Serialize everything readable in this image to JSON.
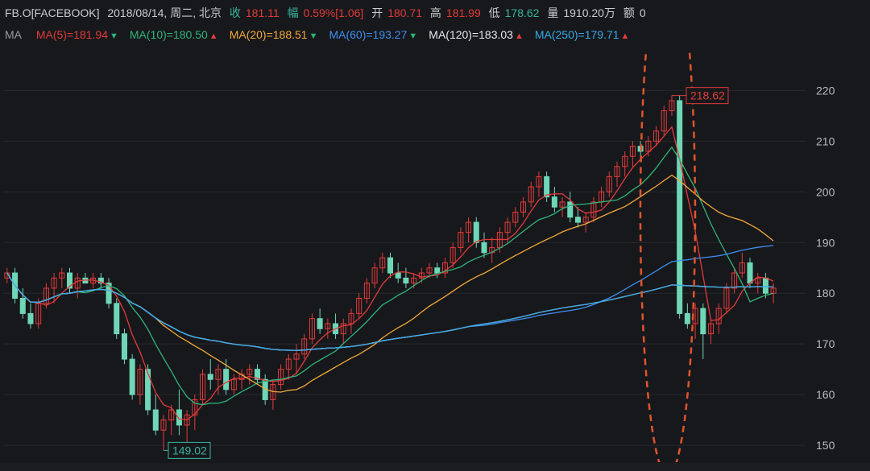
{
  "header": {
    "symbol": "FB.O[FACEBOOK]",
    "datetime": "2018/08/14, 周二, 北京",
    "close_label": "收",
    "close_value": "181.11",
    "change_label": "幅",
    "change_pct": "0.59%",
    "change_abs": "[1.06]",
    "open_label": "开",
    "open_value": "180.71",
    "high_label": "高",
    "high_value": "181.99",
    "low_label": "低",
    "low_value": "178.62",
    "volume_label": "量",
    "volume_value": "1910.20万",
    "amount_label": "额",
    "amount_value": "0"
  },
  "ma_legend": {
    "label": "MA",
    "items": [
      {
        "text": "MA(5)=181.94",
        "dir": "down",
        "color": "#e23b3b"
      },
      {
        "text": "MA(10)=180.50",
        "dir": "up",
        "color": "#2fb67c"
      },
      {
        "text": "MA(20)=188.51",
        "dir": "down",
        "color": "#f2a93b"
      },
      {
        "text": "MA(60)=193.27",
        "dir": "down",
        "color": "#3d8ff0"
      },
      {
        "text": "MA(120)=183.03",
        "dir": "up",
        "color": "#e8e8e8"
      },
      {
        "text": "MA(250)=179.71",
        "dir": "up",
        "color": "#38a9e8"
      }
    ]
  },
  "colors": {
    "background": "#17181b",
    "up_candle": "#e23b3b",
    "down_candle": "#6fd6b6",
    "label_value_red": "#e23b3b",
    "label_value_green": "#38b6a0",
    "annotation": "#e0552c"
  },
  "annotations": {
    "high_label": "218.62",
    "low_label": "149.02"
  },
  "chart_data": {
    "type": "candlestick",
    "y_ticks": [
      150,
      160,
      170,
      180,
      190,
      200,
      210,
      220
    ],
    "ylim": [
      147,
      228
    ],
    "candles": [
      [
        183,
        185,
        182,
        184
      ],
      [
        184,
        185,
        178,
        179
      ],
      [
        179,
        181,
        175,
        176
      ],
      [
        176,
        178,
        173,
        174
      ],
      [
        174,
        179,
        173,
        178
      ],
      [
        178,
        182,
        177,
        181
      ],
      [
        181,
        184,
        178,
        183
      ],
      [
        183,
        185,
        181,
        184
      ],
      [
        184,
        185,
        180,
        181
      ],
      [
        181,
        184,
        179,
        183
      ],
      [
        183,
        184,
        182,
        182
      ],
      [
        182,
        184,
        181,
        183
      ],
      [
        183,
        184,
        181,
        182
      ],
      [
        182,
        183,
        177,
        178
      ],
      [
        178,
        179,
        171,
        172
      ],
      [
        172,
        173,
        166,
        167
      ],
      [
        167,
        168,
        159,
        160
      ],
      [
        160,
        166,
        158,
        165
      ],
      [
        165,
        166,
        156,
        157
      ],
      [
        157,
        160,
        152,
        153
      ],
      [
        153,
        156,
        149,
        155
      ],
      [
        155,
        158,
        152,
        157
      ],
      [
        157,
        161,
        152,
        154
      ],
      [
        154,
        157,
        150,
        156
      ],
      [
        156,
        160,
        153,
        159
      ],
      [
        159,
        165,
        158,
        164
      ],
      [
        164,
        167,
        161,
        163
      ],
      [
        163,
        166,
        160,
        165
      ],
      [
        165,
        167,
        160,
        161
      ],
      [
        161,
        164,
        160,
        163
      ],
      [
        163,
        165,
        161,
        164
      ],
      [
        164,
        166,
        162,
        165
      ],
      [
        165,
        166,
        162,
        163
      ],
      [
        163,
        164,
        158,
        159
      ],
      [
        159,
        163,
        157,
        162
      ],
      [
        162,
        166,
        161,
        165
      ],
      [
        165,
        168,
        163,
        167
      ],
      [
        167,
        170,
        164,
        168
      ],
      [
        168,
        172,
        167,
        171
      ],
      [
        171,
        176,
        170,
        175
      ],
      [
        175,
        177,
        172,
        173
      ],
      [
        173,
        175,
        171,
        174
      ],
      [
        174,
        176,
        171,
        172
      ],
      [
        172,
        175,
        170,
        174
      ],
      [
        174,
        177,
        172,
        176
      ],
      [
        176,
        180,
        175,
        179
      ],
      [
        179,
        183,
        178,
        182
      ],
      [
        182,
        186,
        181,
        185
      ],
      [
        185,
        188,
        184,
        187
      ],
      [
        187,
        188,
        183,
        184
      ],
      [
        184,
        186,
        182,
        183
      ],
      [
        183,
        185,
        181,
        182
      ],
      [
        182,
        184,
        181,
        183
      ],
      [
        183,
        185,
        182,
        184
      ],
      [
        184,
        186,
        183,
        185
      ],
      [
        185,
        186,
        183,
        184
      ],
      [
        184,
        187,
        183,
        186
      ],
      [
        186,
        190,
        185,
        189
      ],
      [
        189,
        193,
        188,
        192
      ],
      [
        192,
        195,
        190,
        194
      ],
      [
        194,
        195,
        189,
        190
      ],
      [
        190,
        192,
        187,
        188
      ],
      [
        188,
        191,
        186,
        189
      ],
      [
        189,
        193,
        188,
        192
      ],
      [
        192,
        195,
        190,
        194
      ],
      [
        194,
        197,
        193,
        196
      ],
      [
        196,
        199,
        195,
        198
      ],
      [
        198,
        202,
        197,
        201
      ],
      [
        201,
        204,
        199,
        203
      ],
      [
        203,
        204,
        198,
        199
      ],
      [
        199,
        201,
        196,
        197
      ],
      [
        197,
        199,
        195,
        198
      ],
      [
        198,
        200,
        194,
        195
      ],
      [
        195,
        197,
        193,
        194
      ],
      [
        194,
        196,
        192,
        195
      ],
      [
        195,
        199,
        194,
        198
      ],
      [
        198,
        201,
        197,
        200
      ],
      [
        200,
        204,
        199,
        203
      ],
      [
        203,
        206,
        201,
        205
      ],
      [
        205,
        208,
        203,
        207
      ],
      [
        207,
        210,
        205,
        209
      ],
      [
        209,
        210,
        206,
        208
      ],
      [
        208,
        211,
        207,
        210
      ],
      [
        210,
        213,
        209,
        212
      ],
      [
        212,
        217,
        211,
        216
      ],
      [
        216,
        219,
        215,
        218
      ],
      [
        218,
        219,
        175,
        176
      ],
      [
        176,
        178,
        173,
        174
      ],
      [
        174,
        178,
        171,
        177
      ],
      [
        177,
        178,
        167,
        172
      ],
      [
        172,
        175,
        170,
        174
      ],
      [
        174,
        178,
        172,
        177
      ],
      [
        177,
        182,
        176,
        181
      ],
      [
        181,
        185,
        180,
        184
      ],
      [
        184,
        188,
        183,
        186
      ],
      [
        186,
        187,
        181,
        182
      ],
      [
        182,
        184,
        180,
        183
      ],
      [
        183,
        184,
        179,
        180
      ],
      [
        180,
        182,
        178,
        181
      ]
    ]
  }
}
